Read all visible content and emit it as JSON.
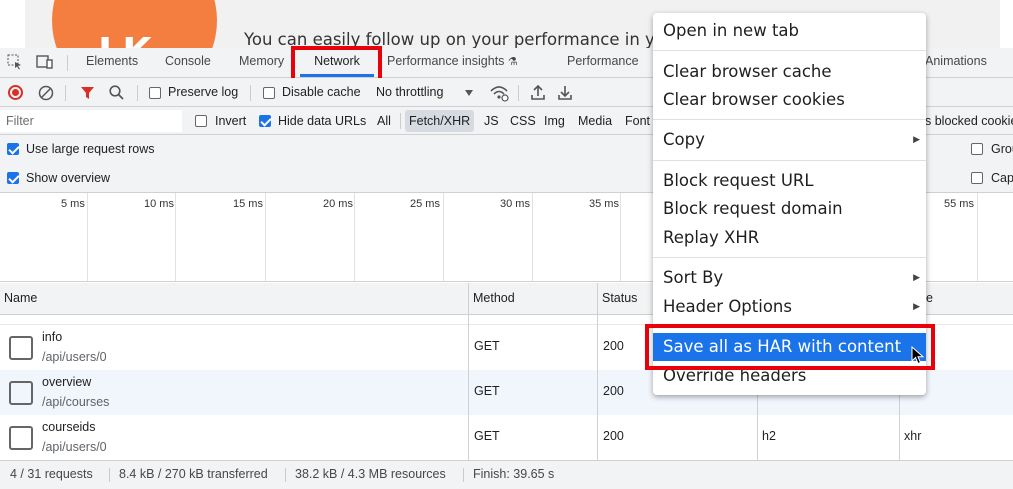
{
  "page": {
    "avatar_initials": "LK",
    "banner_text": "You can easily follow up on your performance in your"
  },
  "tabs": [
    "Elements",
    "Console",
    "Memory",
    "Network",
    "Performance insights",
    "Performance",
    "Animations"
  ],
  "toolbar": {
    "preserve_log": "Preserve log",
    "disable_cache": "Disable cache",
    "throttling": "No throttling"
  },
  "filterbar": {
    "filter_placeholder": "Filter",
    "invert": "Invert",
    "hide_data_urls": "Hide data URLs",
    "types": [
      "All",
      "Fetch/XHR",
      "JS",
      "CSS",
      "Img",
      "Media",
      "Font"
    ],
    "blocked_cookies": "s blocked cookie"
  },
  "options": {
    "large_rows": "Use large request rows",
    "show_overview": "Show overview",
    "group_partial": "Grou",
    "capture_partial": "Cap"
  },
  "timeline_ticks": [
    "5 ms",
    "10 ms",
    "15 ms",
    "20 ms",
    "25 ms",
    "30 ms",
    "35 ms",
    "55 ms"
  ],
  "table": {
    "headers": [
      "Name",
      "Method",
      "Status",
      "e"
    ],
    "rows": [
      {
        "name": "info",
        "path": "/api/users/0",
        "method": "GET",
        "status": "200",
        "protocol": "",
        "type": ""
      },
      {
        "name": "overview",
        "path": "/api/courses",
        "method": "GET",
        "status": "200",
        "protocol": "",
        "type": ""
      },
      {
        "name": "courseids",
        "path": "/api/users/0",
        "method": "GET",
        "status": "200",
        "protocol": "h2",
        "type": "xhr"
      }
    ]
  },
  "statusbar": {
    "requests": "4 / 31 requests",
    "transferred": "8.4 kB / 270 kB transferred",
    "resources": "38.2 kB / 4.3 MB resources",
    "finish": "Finish: 39.65 s"
  },
  "context_menu": {
    "open_new_tab": "Open in new tab",
    "clear_cache": "Clear browser cache",
    "clear_cookies": "Clear browser cookies",
    "copy": "Copy",
    "block_url": "Block request URL",
    "block_domain": "Block request domain",
    "replay_xhr": "Replay XHR",
    "sort_by": "Sort By",
    "header_options": "Header Options",
    "save_har": "Save all as HAR with content",
    "override_headers": "Override headers"
  },
  "colors": {
    "highlight": "#e8000b",
    "accent": "#1a73e8",
    "avatar": "#f47d40"
  }
}
